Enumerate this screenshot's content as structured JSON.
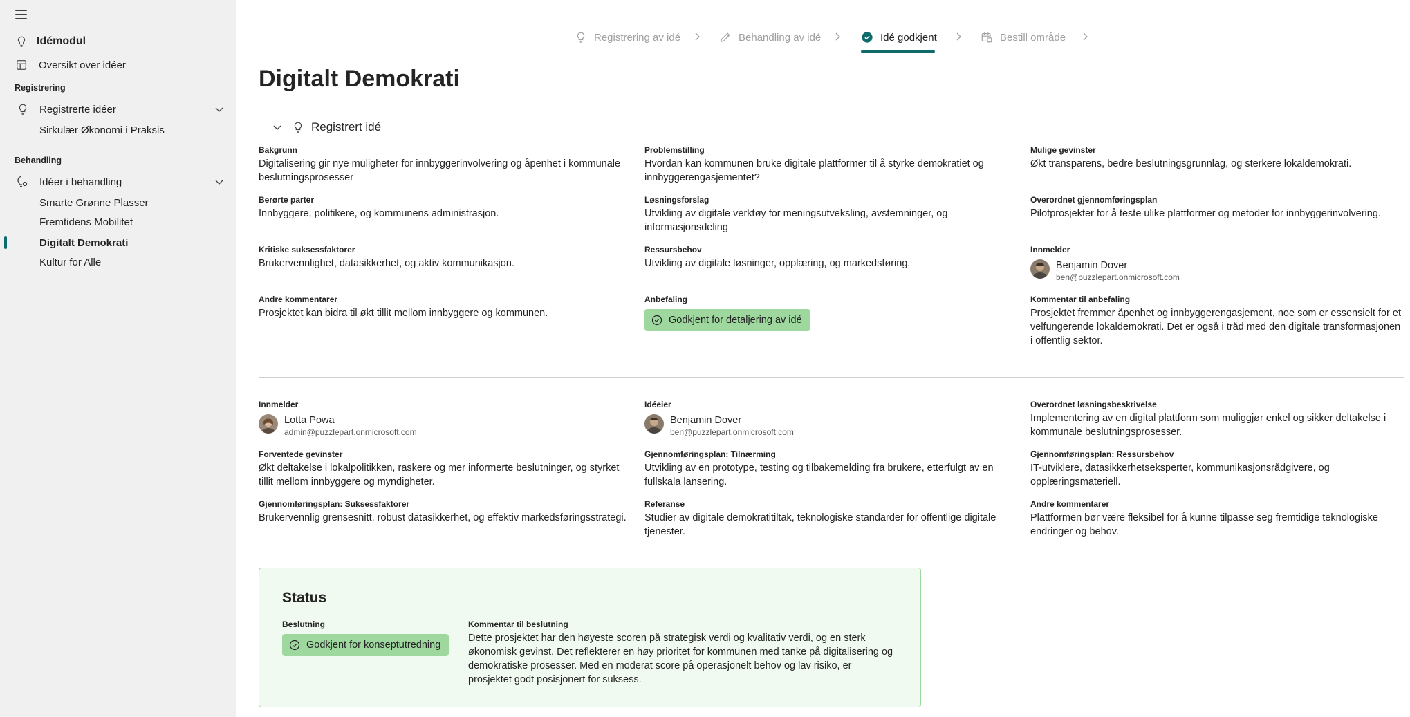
{
  "sidebar": {
    "module_title": "Idémodul",
    "overview": "Oversikt over idéer",
    "section_registrering": "Registrering",
    "registered_group": "Registrerte idéer",
    "registered_items": [
      "Sirkulær Økonomi i Praksis"
    ],
    "section_behandling": "Behandling",
    "processing_group": "Idéer i behandling",
    "processing_items": [
      "Smarte Grønne Plasser",
      "Fremtidens Mobilitet",
      "Digitalt Demokrati",
      "Kultur for Alle"
    ],
    "active_item": "Digitalt Demokrati"
  },
  "stepper": {
    "steps": [
      "Registrering av idé",
      "Behandling av idé",
      "Idé godkjent",
      "Bestill område"
    ],
    "active": "Idé godkjent"
  },
  "page": {
    "title": "Digitalt Demokrati",
    "section_label": "Registrert idé"
  },
  "registered": {
    "bakgrunn": {
      "label": "Bakgrunn",
      "value": "Digitalisering gir nye muligheter for innbyggerinvolvering og åpenhet i kommunale beslutningsprosesser"
    },
    "problemstilling": {
      "label": "Problemstilling",
      "value": "Hvordan kan kommunen bruke digitale plattformer til å styrke demokratiet og innbyggerengasjementet?"
    },
    "mulige_gevinster": {
      "label": "Mulige gevinster",
      "value": "Økt transparens, bedre beslutningsgrunnlag, og sterkere lokaldemokrati."
    },
    "berorte_parter": {
      "label": "Berørte parter",
      "value": "Innbyggere, politikere, og kommunens administrasjon."
    },
    "losningsforslag": {
      "label": "Løsningsforslag",
      "value": "Utvikling av digitale verktøy for meningsutveksling, avstemninger, og informasjonsdeling"
    },
    "overordnet_plan": {
      "label": "Overordnet gjennomføringsplan",
      "value": "Pilotprosjekter for å teste ulike plattformer og metoder for innbyggerinvolvering."
    },
    "kritiske": {
      "label": "Kritiske suksessfaktorer",
      "value": "Brukervennlighet, datasikkerhet, og aktiv kommunikasjon."
    },
    "ressursbehov": {
      "label": "Ressursbehov",
      "value": "Utvikling av digitale løsninger, opplæring, og markedsføring."
    },
    "innmelder": {
      "label": "Innmelder",
      "name": "Benjamin Dover",
      "email": "ben@puzzlepart.onmicrosoft.com"
    },
    "andre": {
      "label": "Andre kommentarer",
      "value": "Prosjektet kan bidra til økt tillit mellom innbyggere og kommunen."
    },
    "anbefaling": {
      "label": "Anbefaling",
      "value": "Godkjent for detaljering av idé"
    },
    "kommentar_anbefaling": {
      "label": "Kommentar til anbefaling",
      "value": "Prosjektet fremmer åpenhet og innbyggerengasjement, noe som er essensielt for et velfungerende lokaldemokrati. Det er også i tråd med den digitale transformasjonen i offentlig sektor."
    }
  },
  "details": {
    "innmelder": {
      "label": "Innmelder",
      "name": "Lotta Powa",
      "email": "admin@puzzlepart.onmicrosoft.com"
    },
    "ideeier": {
      "label": "Idéeier",
      "name": "Benjamin Dover",
      "email": "ben@puzzlepart.onmicrosoft.com"
    },
    "overordnet_losning": {
      "label": "Overordnet løsningsbeskrivelse",
      "value": "Implementering av en digital plattform som muliggjør enkel og sikker deltakelse i kommunale beslutningsprosesser."
    },
    "forventede": {
      "label": "Forventede gevinster",
      "value": "Økt deltakelse i lokalpolitikken, raskere og mer informerte beslutninger, og styrket tillit mellom innbyggere og myndigheter."
    },
    "tilnaerming": {
      "label": "Gjennomføringsplan: Tilnærming",
      "value": "Utvikling av en prototype, testing og tilbakemelding fra brukere, etterfulgt av en fullskala lansering."
    },
    "plan_ressurs": {
      "label": "Gjennomføringsplan: Ressursbehov",
      "value": "IT-utviklere, datasikkerhetseksperter, kommunikasjonsrådgivere, og opplæringsmateriell."
    },
    "plan_suksess": {
      "label": "Gjennomføringsplan: Suksessfaktorer",
      "value": "Brukervennlig grensesnitt, robust datasikkerhet, og effektiv markedsføringsstrategi."
    },
    "referanse": {
      "label": "Referanse",
      "value": "Studier av digitale demokratitiltak, teknologiske standarder for offentlige digitale tjenester."
    },
    "andre": {
      "label": "Andre kommentarer",
      "value": "Plattformen bør være fleksibel for å kunne tilpasse seg fremtidige teknologiske endringer og behov."
    }
  },
  "status": {
    "title": "Status",
    "beslutning_label": "Beslutning",
    "beslutning_value": "Godkjent for konseptutredning",
    "kommentar_label": "Kommentar til beslutning",
    "kommentar_value": "Dette prosjektet har den høyeste scoren på strategisk verdi og kvalitativ verdi, og en sterk økonomisk gevinst. Det reflekterer en høy prioritet for kommunen med tanke på digitalisering og demokratiske prosesser. Med en moderat score på operasjonelt behov og lav risiko, er prosjektet godt posisjonert for suksess."
  },
  "colors": {
    "accent": "#0f6a6a",
    "success_bg": "#9fd89f",
    "status_bg": "#f1faf1",
    "sidebar_bg": "#f0f0f0"
  }
}
